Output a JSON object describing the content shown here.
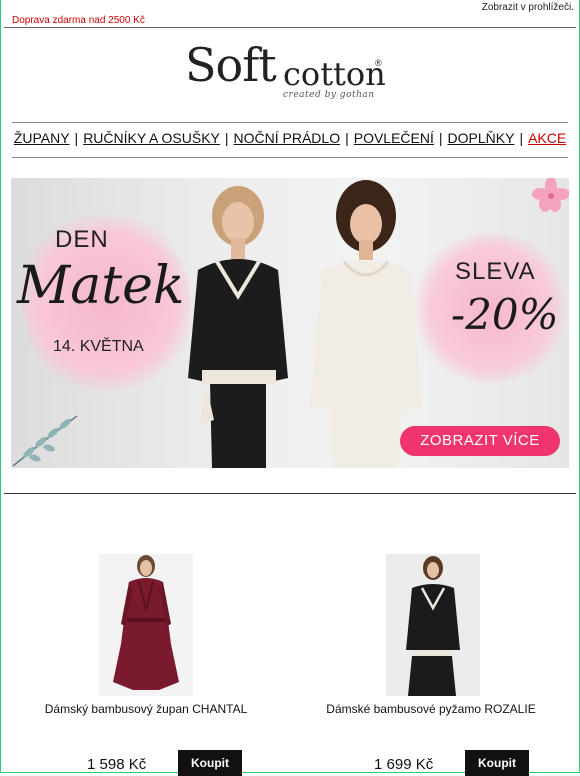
{
  "topbar": {
    "free_shipping": "Doprava zdarma nad 2500 Kč",
    "view_in_browser": "Zobrazit v prohlížeči."
  },
  "logo": {
    "soft": "Soft",
    "cotton": "cotton",
    "registered": "®",
    "tagline": "created by gothan"
  },
  "nav": {
    "items": [
      "ŽUPANY",
      "RUČNÍKY A OSUŠKY",
      "NOČNÍ PRÁDLO",
      "POVLEČENÍ",
      "DOPLŇKY",
      "AKCE"
    ],
    "separator": "|"
  },
  "banner": {
    "den": "DEN",
    "matek": "Matek",
    "date": "14. KVĚTNA",
    "sleva": "SLEVA",
    "discount": "-20%",
    "cta": "ZOBRAZIT VÍCE"
  },
  "products": [
    {
      "name": "Dámský bambusový župan CHANTAL",
      "price": "1 598 Kč",
      "buy": "Koupit",
      "color": "#7a1a2e"
    },
    {
      "name": "Dámské bambusové pyžamo ROZALIE",
      "price": "1 699 Kč",
      "buy": "Koupit",
      "color": "#1b1b1b"
    }
  ],
  "colors": {
    "sale_red": "#cc0000",
    "cta_pink": "#f0356e",
    "frame_green": "#2ecc71"
  }
}
